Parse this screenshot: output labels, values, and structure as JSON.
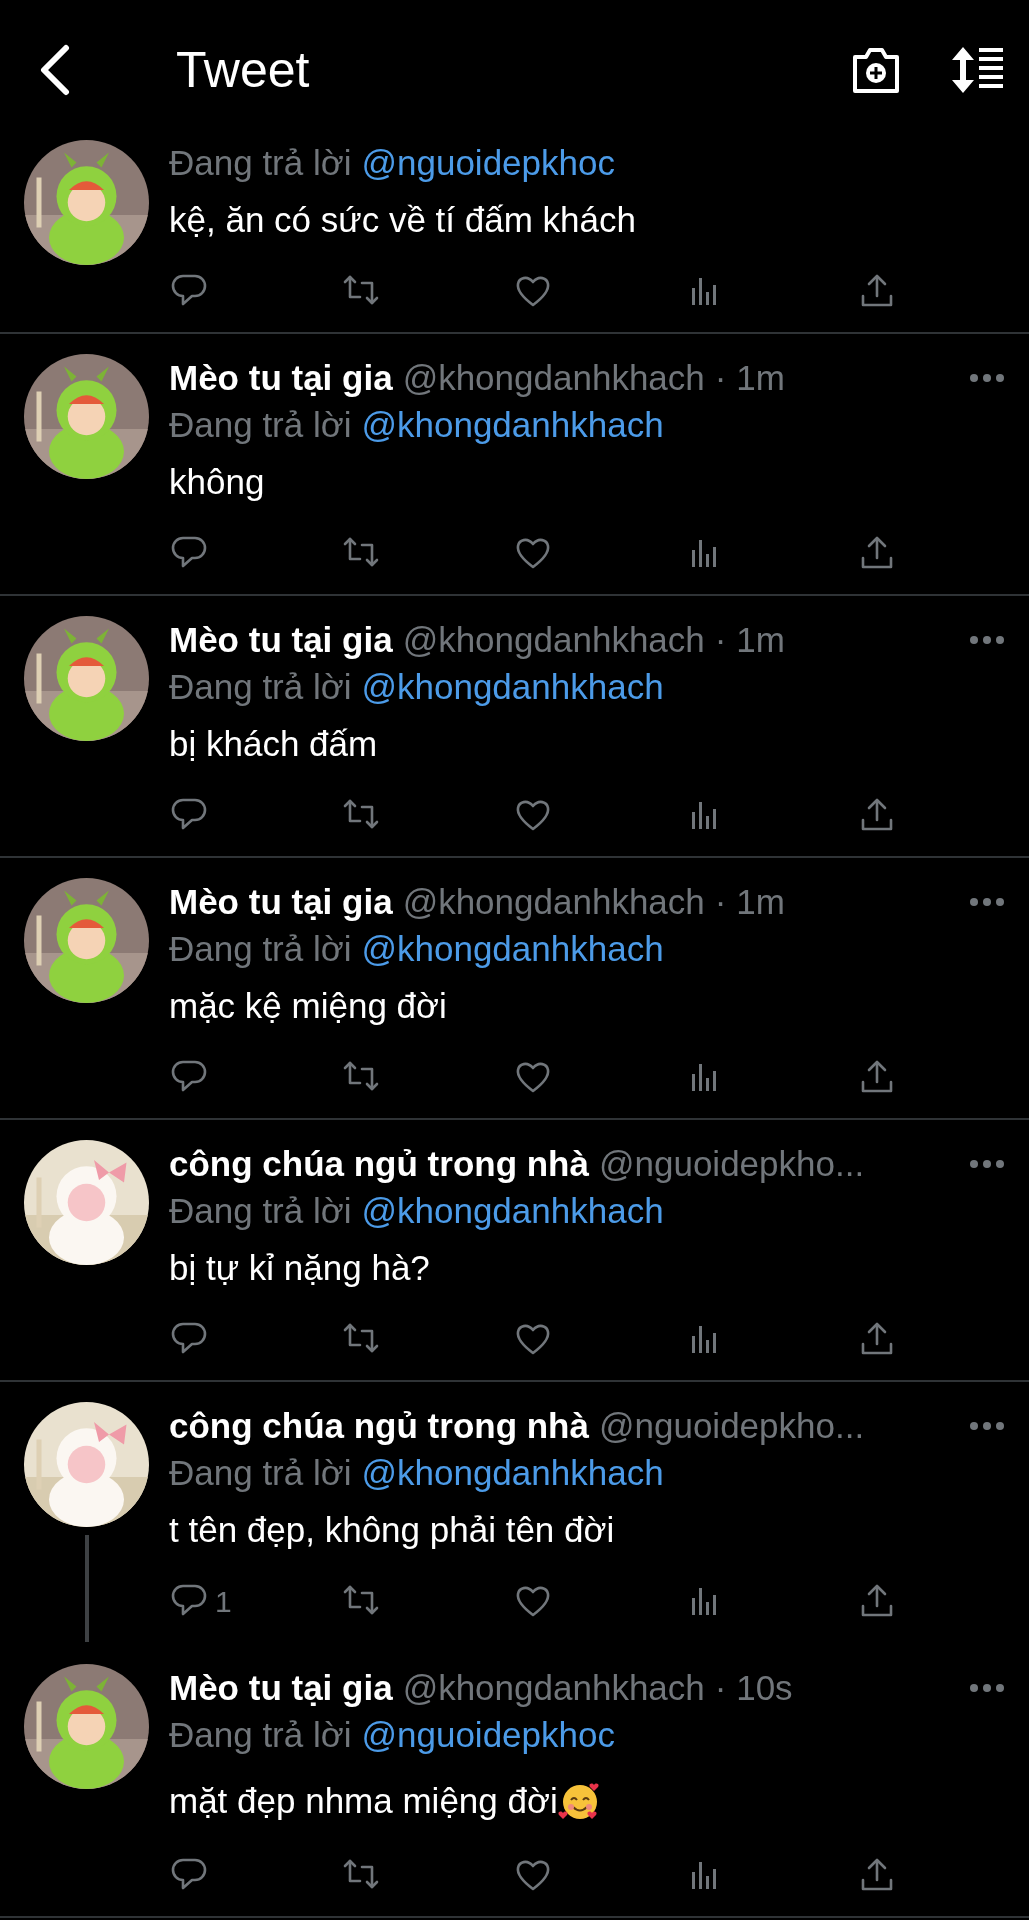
{
  "header": {
    "title": "Tweet"
  },
  "tweets": [
    {
      "reply_to_label": "Đang trả lời",
      "reply_to": "@nguoidepkhoc",
      "text": "kệ, ăn có sức về tí đấm khách",
      "connected": false,
      "partial": true
    },
    {
      "name": "Mèo tu tại gia",
      "handle": "@khongdanhkhach",
      "time": "· 1m",
      "reply_to_label": "Đang trả lời",
      "reply_to": "@khongdanhkhach",
      "text": "không",
      "connected": false
    },
    {
      "name": "Mèo tu tại gia",
      "handle": "@khongdanhkhach",
      "time": "· 1m",
      "reply_to_label": "Đang trả lời",
      "reply_to": "@khongdanhkhach",
      "text": "bị khách đấm",
      "connected": false
    },
    {
      "name": "Mèo tu tại gia",
      "handle": "@khongdanhkhach",
      "time": "· 1m",
      "reply_to_label": "Đang trả lời",
      "reply_to": "@khongdanhkhach",
      "text": "mặc kệ miệng đời",
      "connected": false
    },
    {
      "name": "công chúa ngủ trong nhà",
      "handle": "@nguoidepkho...",
      "reply_to_label": "Đang trả lời",
      "reply_to": "@khongdanhkhach",
      "text": "bị tự kỉ nặng hà?",
      "connected": false
    },
    {
      "name": "công chúa ngủ trong nhà",
      "handle": "@nguoidepkho...",
      "reply_to_label": "Đang trả lời",
      "reply_to": "@khongdanhkhach",
      "text": "t tên đẹp, không phải tên đời",
      "connected": true,
      "reply_count": "1"
    },
    {
      "name": "Mèo tu tại gia",
      "handle": "@khongdanhkhach",
      "time": "· 10s",
      "reply_to_label": "Đang trả lời",
      "reply_to": "@nguoidepkhoc",
      "text": "mặt đẹp nhma miệng đời",
      "emoji": {
        "kind": "smiling_face_with_hearts"
      },
      "connected": false
    }
  ]
}
